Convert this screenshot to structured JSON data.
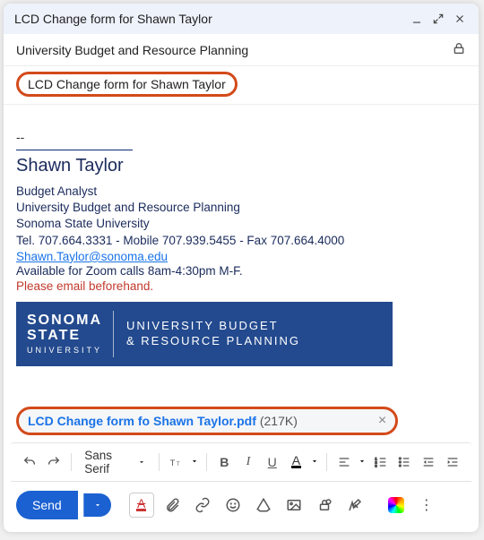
{
  "window": {
    "title": "LCD Change form for Shawn Taylor"
  },
  "recipients": {
    "to": "University Budget and Resource Planning"
  },
  "subject": "LCD Change form for Shawn Taylor",
  "signature": {
    "dash": "--",
    "name": "Shawn Taylor",
    "title": "Budget Analyst",
    "dept": "University Budget and Resource Planning",
    "org": "Sonoma State University",
    "phones": "Tel. 707.664.3331 - Mobile 707.939.5455 - Fax 707.664.4000",
    "email": "Shawn.Taylor@sonoma.edu",
    "avail": "Available for Zoom calls 8am-4:30pm M-F.",
    "warn": "Please email beforehand."
  },
  "banner": {
    "left1": "SONOMA",
    "left2": "STATE",
    "left3": "UNIVERSITY",
    "right1": "UNIVERSITY BUDGET",
    "right2": "& RESOURCE PLANNING"
  },
  "attachment": {
    "name": "LCD Change form fo Shawn Taylor.pdf",
    "size": "(217K)",
    "remove": "×"
  },
  "format_toolbar": {
    "font": "Sans Serif",
    "bold": "B",
    "italic": "I",
    "underline": "U",
    "color": "A",
    "strike": "A"
  },
  "actions": {
    "send": "Send",
    "more": "⋮"
  }
}
